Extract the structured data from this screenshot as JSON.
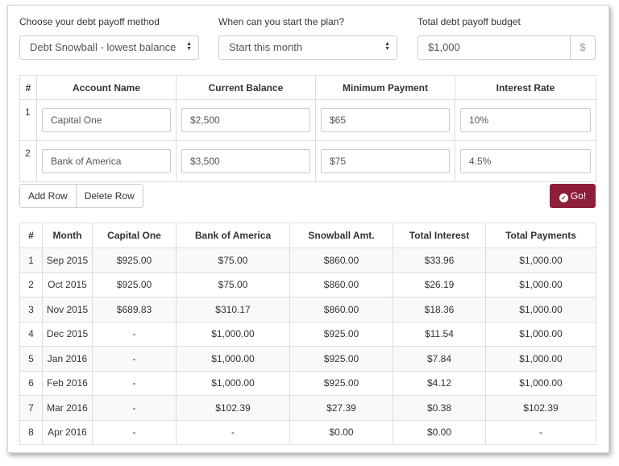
{
  "controls": {
    "method_label": "Choose your debt payoff method",
    "method_value": "Debt Snowball - lowest balance",
    "start_label": "When can you start the plan?",
    "start_value": "Start this month",
    "budget_label": "Total debt payoff budget",
    "budget_value": "$1,000",
    "budget_addon": "$"
  },
  "accounts": {
    "headers": [
      "#",
      "Account Name",
      "Current Balance",
      "Minimum Payment",
      "Interest Rate"
    ],
    "rows": [
      {
        "num": "1",
        "name": "Capital One",
        "balance": "$2,500",
        "min": "$65",
        "rate": "10%"
      },
      {
        "num": "2",
        "name": "Bank of America",
        "balance": "$3,500",
        "min": "$75",
        "rate": "4.5%"
      }
    ]
  },
  "buttons": {
    "add_row": "Add Row",
    "delete_row": "Delete Row",
    "go": "Go!"
  },
  "schedule": {
    "headers": [
      "#",
      "Month",
      "Capital One",
      "Bank of America",
      "Snowball Amt.",
      "Total Interest",
      "Total Payments"
    ],
    "rows": [
      [
        "1",
        "Sep 2015",
        "$925.00",
        "$75.00",
        "$860.00",
        "$33.96",
        "$1,000.00"
      ],
      [
        "2",
        "Oct 2015",
        "$925.00",
        "$75.00",
        "$860.00",
        "$26.19",
        "$1,000.00"
      ],
      [
        "3",
        "Nov 2015",
        "$689.83",
        "$310.17",
        "$860.00",
        "$18.36",
        "$1,000.00"
      ],
      [
        "4",
        "Dec 2015",
        "-",
        "$1,000.00",
        "$925.00",
        "$11.54",
        "$1,000.00"
      ],
      [
        "5",
        "Jan 2016",
        "-",
        "$1,000.00",
        "$925.00",
        "$7.84",
        "$1,000.00"
      ],
      [
        "6",
        "Feb 2016",
        "-",
        "$1,000.00",
        "$925.00",
        "$4.12",
        "$1,000.00"
      ],
      [
        "7",
        "Mar 2016",
        "-",
        "$102.39",
        "$27.39",
        "$0.38",
        "$102.39"
      ],
      [
        "8",
        "Apr 2016",
        "-",
        "-",
        "$0.00",
        "$0.00",
        "-"
      ]
    ]
  },
  "colors": {
    "go_button": "#8e1f3b",
    "stripe": "#f9f9f9",
    "border": "#dddddd"
  },
  "icons": {
    "go": "check-circle-icon",
    "select": "up-down-arrows-icon"
  }
}
